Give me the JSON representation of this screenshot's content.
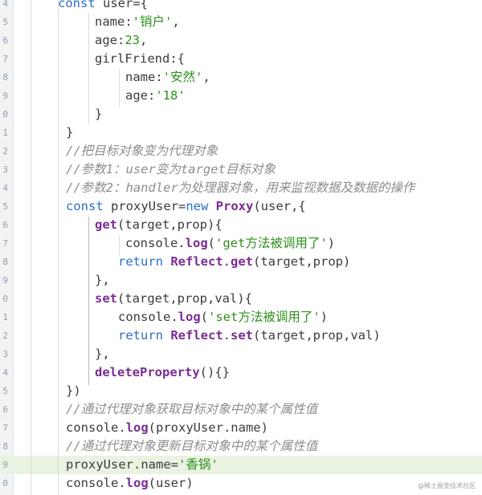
{
  "editor": {
    "watermark": "@稀土掘金技术社区",
    "lines": [
      {
        "num": "4",
        "indent": 72,
        "highlight": false,
        "tokens": [
          {
            "t": "const",
            "c": "kw"
          },
          {
            "t": " user={",
            "c": "plain"
          }
        ]
      },
      {
        "num": "5",
        "indent": 118,
        "highlight": false,
        "tokens": [
          {
            "t": "name:",
            "c": "plain"
          },
          {
            "t": "'销户'",
            "c": "str"
          },
          {
            "t": ",",
            "c": "plain"
          }
        ]
      },
      {
        "num": "6",
        "indent": 118,
        "highlight": false,
        "tokens": [
          {
            "t": "age:",
            "c": "plain"
          },
          {
            "t": "23",
            "c": "num"
          },
          {
            "t": ",",
            "c": "plain"
          }
        ]
      },
      {
        "num": "7",
        "indent": 118,
        "highlight": false,
        "tokens": [
          {
            "t": "girlFriend:{",
            "c": "plain"
          }
        ]
      },
      {
        "num": "8",
        "indent": 156,
        "highlight": false,
        "tokens": [
          {
            "t": "name:",
            "c": "plain"
          },
          {
            "t": "'安然'",
            "c": "str"
          },
          {
            "t": ",",
            "c": "plain"
          }
        ]
      },
      {
        "num": "9",
        "indent": 156,
        "highlight": false,
        "tokens": [
          {
            "t": "age:",
            "c": "plain"
          },
          {
            "t": "'18'",
            "c": "str"
          }
        ]
      },
      {
        "num": "0",
        "indent": 118,
        "highlight": false,
        "tokens": [
          {
            "t": "}",
            "c": "plain"
          }
        ]
      },
      {
        "num": "1",
        "indent": 82,
        "highlight": false,
        "tokens": [
          {
            "t": "}",
            "c": "plain"
          }
        ]
      },
      {
        "num": "2",
        "indent": 82,
        "highlight": false,
        "tokens": [
          {
            "t": "//把目标对象变为代理对象",
            "c": "cmt"
          }
        ]
      },
      {
        "num": "3",
        "indent": 82,
        "highlight": false,
        "tokens": [
          {
            "t": "//参数1：user变为target目标对象",
            "c": "cmt"
          }
        ]
      },
      {
        "num": "4",
        "indent": 82,
        "highlight": false,
        "tokens": [
          {
            "t": "//参数2：handler为处理器对象，用来监视数据及数据的操作",
            "c": "cmt"
          }
        ]
      },
      {
        "num": "5",
        "indent": 82,
        "highlight": false,
        "tokens": [
          {
            "t": "const",
            "c": "kw"
          },
          {
            "t": " proxyUser=",
            "c": "plain"
          },
          {
            "t": "new",
            "c": "kw"
          },
          {
            "t": " ",
            "c": "plain"
          },
          {
            "t": "Proxy",
            "c": "fn"
          },
          {
            "t": "(user,{",
            "c": "plain"
          }
        ]
      },
      {
        "num": "6",
        "indent": 118,
        "highlight": false,
        "tokens": [
          {
            "t": "get",
            "c": "fn"
          },
          {
            "t": "(target,prop){",
            "c": "plain"
          }
        ]
      },
      {
        "num": "7",
        "indent": 156,
        "highlight": false,
        "tokens": [
          {
            "t": "console.",
            "c": "plain"
          },
          {
            "t": "log",
            "c": "fn"
          },
          {
            "t": "(",
            "c": "plain"
          },
          {
            "t": "'get方法被调用了'",
            "c": "str"
          },
          {
            "t": ")",
            "c": "plain"
          }
        ]
      },
      {
        "num": "8",
        "indent": 147,
        "highlight": false,
        "tokens": [
          {
            "t": "return",
            "c": "kw"
          },
          {
            "t": " ",
            "c": "plain"
          },
          {
            "t": "Reflect",
            "c": "fn"
          },
          {
            "t": ".",
            "c": "plain"
          },
          {
            "t": "get",
            "c": "fn"
          },
          {
            "t": "(target,prop)",
            "c": "plain"
          }
        ]
      },
      {
        "num": "9",
        "indent": 118,
        "highlight": false,
        "tokens": [
          {
            "t": "},",
            "c": "plain"
          }
        ]
      },
      {
        "num": "0",
        "indent": 118,
        "highlight": false,
        "tokens": [
          {
            "t": "set",
            "c": "fn"
          },
          {
            "t": "(target,prop,val){",
            "c": "plain"
          }
        ]
      },
      {
        "num": "1",
        "indent": 147,
        "highlight": false,
        "tokens": [
          {
            "t": "console.",
            "c": "plain"
          },
          {
            "t": "log",
            "c": "fn"
          },
          {
            "t": "(",
            "c": "plain"
          },
          {
            "t": "'set方法被调用了'",
            "c": "str"
          },
          {
            "t": ")",
            "c": "plain"
          }
        ]
      },
      {
        "num": "2",
        "indent": 147,
        "highlight": false,
        "tokens": [
          {
            "t": "return",
            "c": "kw"
          },
          {
            "t": " ",
            "c": "plain"
          },
          {
            "t": "Reflect",
            "c": "fn"
          },
          {
            "t": ".",
            "c": "plain"
          },
          {
            "t": "set",
            "c": "fn"
          },
          {
            "t": "(target,prop,val)",
            "c": "plain"
          }
        ]
      },
      {
        "num": "3",
        "indent": 118,
        "highlight": false,
        "tokens": [
          {
            "t": "},",
            "c": "plain"
          }
        ]
      },
      {
        "num": "4",
        "indent": 118,
        "highlight": false,
        "tokens": [
          {
            "t": "deleteProperty",
            "c": "fn"
          },
          {
            "t": "(){}",
            "c": "plain"
          }
        ]
      },
      {
        "num": "5",
        "indent": 82,
        "highlight": false,
        "tokens": [
          {
            "t": "})",
            "c": "plain"
          }
        ]
      },
      {
        "num": "6",
        "indent": 82,
        "highlight": false,
        "tokens": [
          {
            "t": "//通过代理对象获取目标对象中的某个属性值",
            "c": "cmt"
          }
        ]
      },
      {
        "num": "7",
        "indent": 82,
        "highlight": false,
        "tokens": [
          {
            "t": "console.",
            "c": "plain"
          },
          {
            "t": "log",
            "c": "fn"
          },
          {
            "t": "(proxyUser.name)",
            "c": "plain"
          }
        ]
      },
      {
        "num": "8",
        "indent": 82,
        "highlight": false,
        "tokens": [
          {
            "t": "//通过代理对象更新目标对象中的某个属性值",
            "c": "cmt"
          }
        ]
      },
      {
        "num": "9",
        "indent": 82,
        "highlight": true,
        "tokens": [
          {
            "t": "proxyUser.name=",
            "c": "plain"
          },
          {
            "t": "'香锅'",
            "c": "str"
          }
        ]
      },
      {
        "num": "0",
        "indent": 82,
        "highlight": false,
        "tokens": [
          {
            "t": "console.",
            "c": "plain"
          },
          {
            "t": "log",
            "c": "fn"
          },
          {
            "t": "(user)",
            "c": "plain"
          }
        ]
      }
    ]
  }
}
